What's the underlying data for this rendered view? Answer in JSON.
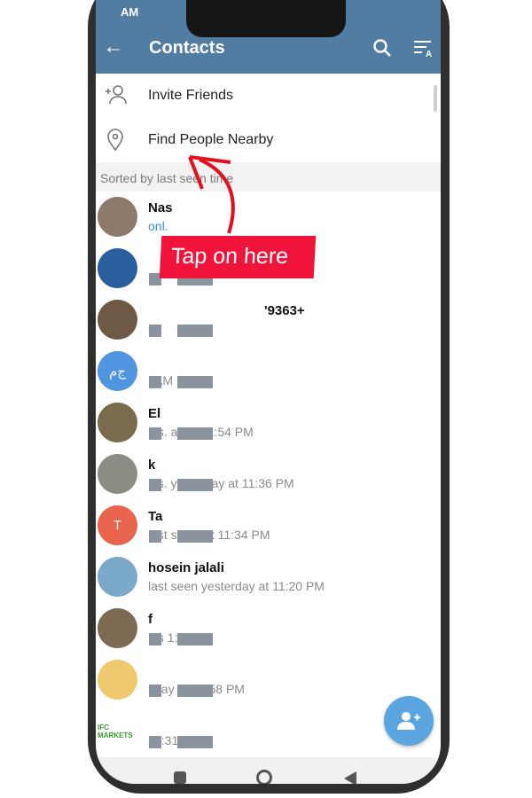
{
  "status_bar": {
    "time_fragment": "AM"
  },
  "header": {
    "title": "Contacts",
    "back_icon": "arrow-left-icon",
    "search_icon": "search-icon",
    "sort_icon": "sort-az-icon"
  },
  "menu": [
    {
      "label": "Invite Friends",
      "icon": "add-person-icon"
    },
    {
      "label": "Find People Nearby",
      "icon": "location-pin-icon"
    }
  ],
  "section_header": "Sorted by last seen time",
  "contacts": [
    {
      "name": "Nas",
      "status": "onl.",
      "online": true,
      "avatar_color": "#8d7a6a"
    },
    {
      "name": "",
      "status": "la",
      "avatar_color": "#2a5f9e"
    },
    {
      "name": "'9363+",
      "status": "la",
      "avatar_color": "#6e5a44"
    },
    {
      "name": "",
      "status": ": AM",
      "avatar_color": "#4f95e0",
      "initials": "ج‌م"
    },
    {
      "name": "El",
      "status": "las.  ay at 11:54 PM",
      "avatar_color": "#7a6a4e"
    },
    {
      "name": "k",
      "status": "las.  yesterday at 11:36 PM",
      "avatar_color": "#8c8c84"
    },
    {
      "name": "Ta",
      "status": "last se  ay at 11:34 PM",
      "avatar_color": "#e8644c",
      "initials": "T"
    },
    {
      "name": "hosein jalali",
      "status": "last seen yesterday at 11:20 PM",
      "avatar_color": "#7aa8c8"
    },
    {
      "name": "f",
      "status": "las  1:12 PM",
      "avatar_color": "#7e6a52"
    },
    {
      "name": "",
      "status": "la  ay at 10:58 PM",
      "avatar_color": "#f0c870"
    },
    {
      "name": "",
      "status": "la  :31 PM",
      "avatar_color": "#ffffff",
      "logo": "IFC MARKETS"
    }
  ],
  "fab": {
    "icon": "add-contact-icon"
  },
  "annotation": {
    "text": "Tap on here",
    "color": "#f0143a"
  },
  "colors": {
    "header": "#517da2",
    "online": "#3a8fd4",
    "fab": "#5aa5e0"
  }
}
